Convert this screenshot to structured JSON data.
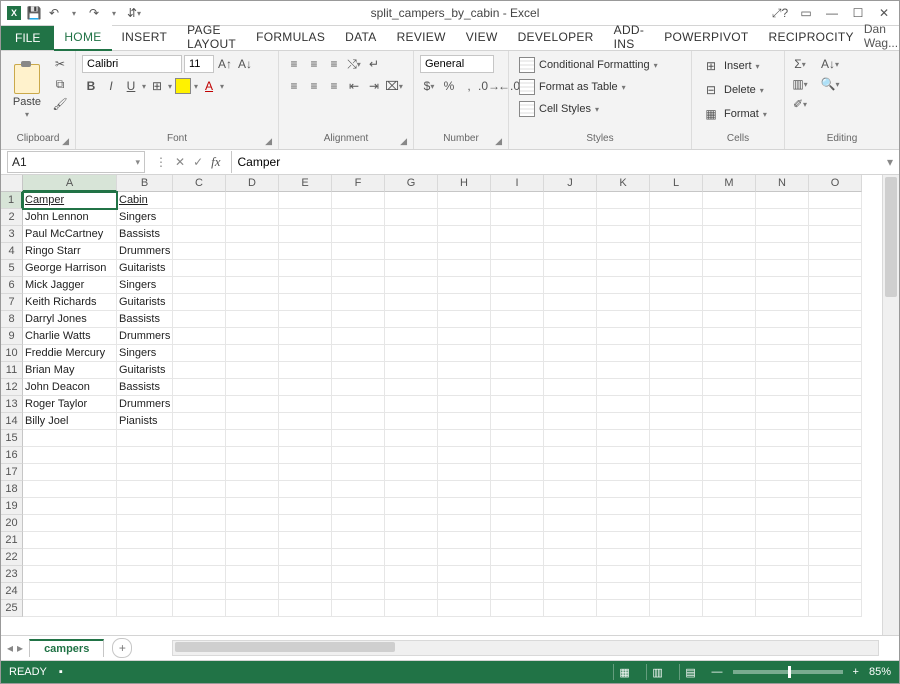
{
  "window": {
    "title": "split_campers_by_cabin - Excel"
  },
  "user": {
    "name": "Dan Wag..."
  },
  "tabs": {
    "file": "FILE",
    "list": [
      "HOME",
      "INSERT",
      "PAGE LAYOUT",
      "FORMULAS",
      "DATA",
      "REVIEW",
      "VIEW",
      "DEVELOPER",
      "ADD-INS",
      "POWERPIVOT",
      "RECIPROCITY"
    ],
    "active": "HOME"
  },
  "ribbon": {
    "clipboard": {
      "paste": "Paste",
      "label": "Clipboard"
    },
    "font": {
      "name": "Calibri",
      "size": "11",
      "label": "Font"
    },
    "alignment": {
      "label": "Alignment"
    },
    "number": {
      "format": "General",
      "label": "Number"
    },
    "styles": {
      "conditional": "Conditional Formatting",
      "table": "Format as Table",
      "cell": "Cell Styles",
      "label": "Styles"
    },
    "cells": {
      "insert": "Insert",
      "delete": "Delete",
      "format": "Format",
      "label": "Cells"
    },
    "editing": {
      "label": "Editing"
    }
  },
  "formula_bar": {
    "name_box": "A1",
    "value": "Camper"
  },
  "columns": [
    "A",
    "B",
    "C",
    "D",
    "E",
    "F",
    "G",
    "H",
    "I",
    "J",
    "K",
    "L",
    "M",
    "N",
    "O"
  ],
  "rows": [
    1,
    2,
    3,
    4,
    5,
    6,
    7,
    8,
    9,
    10,
    11,
    12,
    13,
    14,
    15,
    16,
    17,
    18,
    19,
    20,
    21,
    22,
    23,
    24,
    25
  ],
  "active_cell": {
    "row": 1,
    "col": "A"
  },
  "data": {
    "headers": [
      "Camper",
      "Cabin"
    ],
    "rows": [
      [
        "John Lennon",
        "Singers"
      ],
      [
        "Paul McCartney",
        "Bassists"
      ],
      [
        "Ringo Starr",
        "Drummers"
      ],
      [
        "George Harrison",
        "Guitarists"
      ],
      [
        "Mick Jagger",
        "Singers"
      ],
      [
        "Keith Richards",
        "Guitarists"
      ],
      [
        "Darryl Jones",
        "Bassists"
      ],
      [
        "Charlie Watts",
        "Drummers"
      ],
      [
        "Freddie Mercury",
        "Singers"
      ],
      [
        "Brian May",
        "Guitarists"
      ],
      [
        "John Deacon",
        "Bassists"
      ],
      [
        "Roger Taylor",
        "Drummers"
      ],
      [
        "Billy Joel",
        "Pianists"
      ]
    ]
  },
  "sheets": {
    "active": "campers"
  },
  "status": {
    "text": "READY",
    "zoom": "85%"
  }
}
